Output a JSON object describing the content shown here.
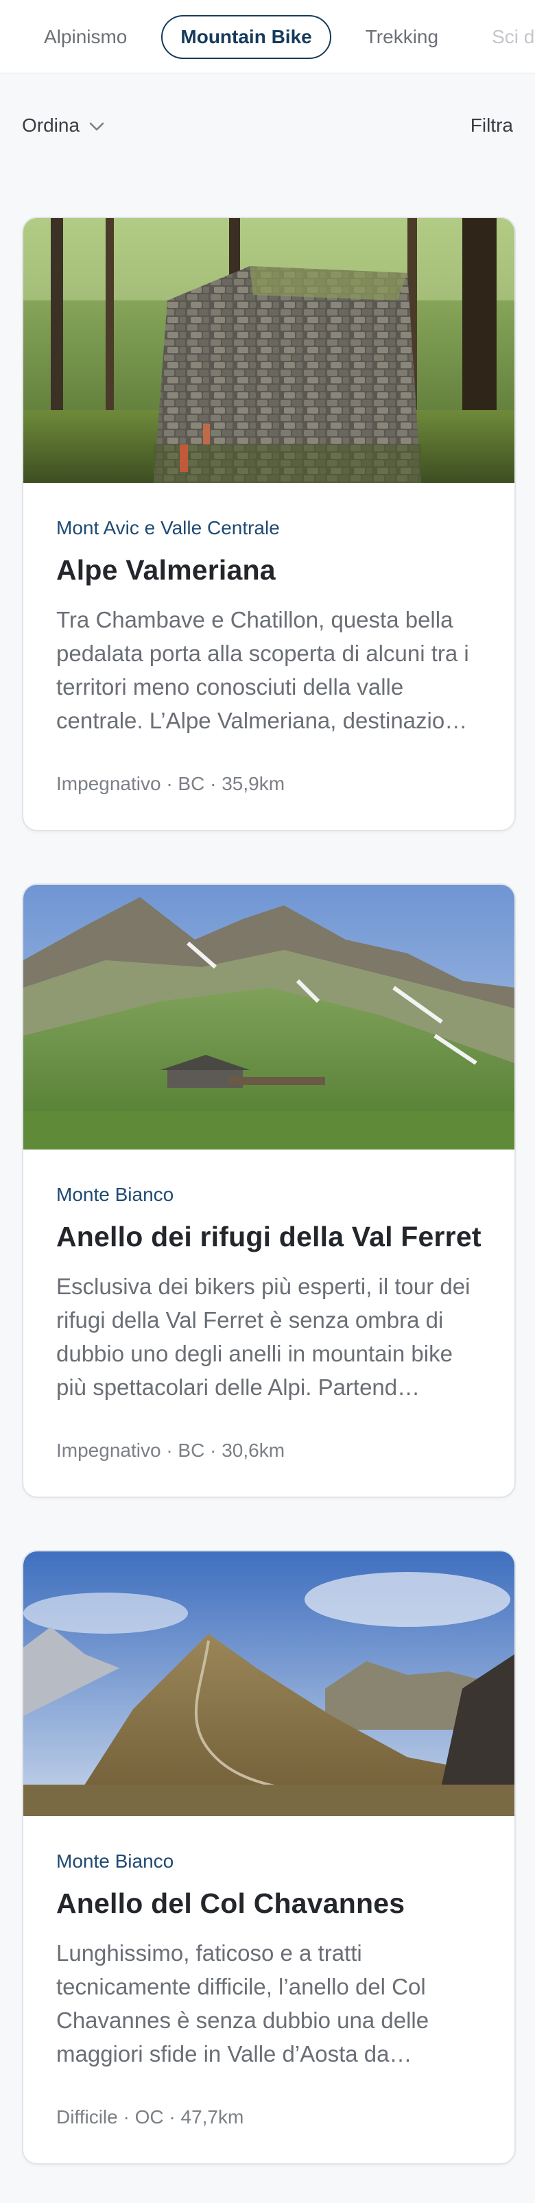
{
  "tabs": [
    {
      "label": "Alpinismo"
    },
    {
      "label": "Mountain Bike"
    },
    {
      "label": "Trekking"
    },
    {
      "label": "Sci di"
    }
  ],
  "controls": {
    "sort_label": "Ordina",
    "filter_label": "Filtra"
  },
  "cards": [
    {
      "region": "Mont Avic e Valle Centrale",
      "title": "Alpe Valmeriana",
      "description": "Tra Chambave e Chatillon, questa bella pedalata porta alla scoperta di alcuni tra i territori meno conosciuti della valle centrale. L’Alpe Valmeriana, destinazio…",
      "meta": "Impegnativo · BC · 35,9km"
    },
    {
      "region": "Monte Bianco",
      "title": "Anello dei rifugi della Val Ferret",
      "description": "Esclusiva dei bikers più esperti, il tour dei rifugi della Val Ferret è senza ombra di dubbio uno degli anelli in mountain bike più spettacolari delle Alpi. Partend…",
      "meta": "Impegnativo · BC · 30,6km"
    },
    {
      "region": "Monte Bianco",
      "title": "Anello del Col Chavannes",
      "description": "Lunghissimo, faticoso e a tratti tecnicamente difficile, l’anello del Col Chavannes è senza dubbio una delle maggiori sfide in Valle d’Aosta da…",
      "meta": "Difficile · OC · 47,7km"
    }
  ],
  "icons": {
    "sort": "chevron-down-icon"
  },
  "colors": {
    "accent": "#153a5b",
    "region": "#1f4a73"
  }
}
